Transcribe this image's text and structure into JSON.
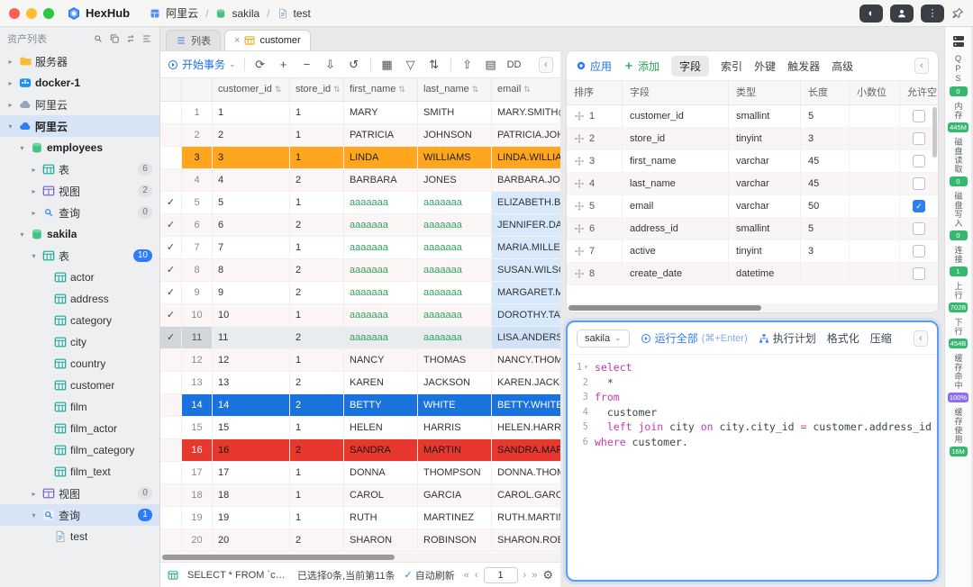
{
  "titlebar": {
    "logo": "HexHub",
    "breadcrumb": [
      {
        "icon": "grid-bc",
        "label": "阿里云"
      },
      {
        "icon": "db",
        "label": "sakila"
      },
      {
        "icon": "doc",
        "label": "test"
      }
    ],
    "right_icons": [
      "theme-toggle-icon",
      "user-icon",
      "more-icon",
      "pin-icon"
    ]
  },
  "sidebar": {
    "header": "资产列表",
    "tools": [
      "search-icon",
      "copy-icon",
      "swap-icon",
      "collapse-icon"
    ],
    "items": [
      {
        "id": "servers",
        "depth": 0,
        "arrow": "r",
        "icon": "folder",
        "label": "服务器"
      },
      {
        "id": "docker-1",
        "depth": 0,
        "arrow": "r",
        "icon": "docker",
        "label": "docker-1",
        "bold": true
      },
      {
        "id": "aliyun",
        "depth": 0,
        "arrow": "r",
        "icon": "cloud",
        "label": "阿里云"
      },
      {
        "id": "aliyun-active",
        "depth": 0,
        "arrow": "d",
        "icon": "cloudblue",
        "label": "阿里云",
        "bold": true,
        "selected": true
      },
      {
        "id": "employees",
        "depth": 1,
        "arrow": "d",
        "icon": "db",
        "label": "employees",
        "bold": true
      },
      {
        "id": "employees-tables",
        "depth": 2,
        "arrow": "r",
        "icon": "table",
        "label": "表",
        "badge": "6"
      },
      {
        "id": "employees-views",
        "depth": 2,
        "arrow": "r",
        "icon": "view",
        "label": "视图",
        "badge": "2"
      },
      {
        "id": "employees-queries",
        "depth": 2,
        "arrow": "r",
        "icon": "query",
        "label": "查询",
        "badge": "0"
      },
      {
        "id": "sakila",
        "depth": 1,
        "arrow": "d",
        "icon": "db",
        "label": "sakila",
        "bold": true
      },
      {
        "id": "sakila-tables",
        "depth": 2,
        "arrow": "d",
        "icon": "table",
        "label": "表",
        "badge": "10",
        "badgeBlue": true
      },
      {
        "id": "table-actor",
        "depth": 3,
        "icon": "table",
        "label": "actor"
      },
      {
        "id": "table-address",
        "depth": 3,
        "icon": "table",
        "label": "address"
      },
      {
        "id": "table-category",
        "depth": 3,
        "icon": "table",
        "label": "category"
      },
      {
        "id": "table-city",
        "depth": 3,
        "icon": "table",
        "label": "city"
      },
      {
        "id": "table-country",
        "depth": 3,
        "icon": "table",
        "label": "country"
      },
      {
        "id": "table-customer",
        "depth": 3,
        "icon": "table",
        "label": "customer"
      },
      {
        "id": "table-film",
        "depth": 3,
        "icon": "table",
        "label": "film"
      },
      {
        "id": "table-film-actor",
        "depth": 3,
        "icon": "table",
        "label": "film_actor"
      },
      {
        "id": "table-film-category",
        "depth": 3,
        "icon": "table",
        "label": "film_category"
      },
      {
        "id": "table-film-text",
        "depth": 3,
        "icon": "table",
        "label": "film_text"
      },
      {
        "id": "sakila-views",
        "depth": 2,
        "arrow": "r",
        "icon": "view",
        "label": "视图",
        "badge": "0"
      },
      {
        "id": "sakila-queries",
        "depth": 2,
        "arrow": "d",
        "icon": "query",
        "label": "查询",
        "badge": "1",
        "badgeBlue": true,
        "selected": true
      },
      {
        "id": "query-test",
        "depth": 3,
        "icon": "doc",
        "label": "test"
      }
    ]
  },
  "tabs": [
    {
      "id": "list",
      "icon": "list",
      "label": "列表",
      "active": false,
      "closable": false
    },
    {
      "id": "customer",
      "icon": "tableorange",
      "label": "customer",
      "active": true,
      "closable": true
    }
  ],
  "toolbar": {
    "transaction": "开始事务",
    "icons": [
      {
        "name": "refresh-icon",
        "glyph": "⟳"
      },
      {
        "name": "add-row-icon",
        "glyph": "+"
      },
      {
        "name": "delete-row-icon",
        "glyph": "−"
      },
      {
        "name": "export-icon",
        "glyph": "⇩"
      },
      {
        "name": "undo-icon",
        "glyph": "↺"
      },
      {
        "name": "divider",
        "glyph": ""
      },
      {
        "name": "grid-view-icon",
        "glyph": "▦"
      },
      {
        "name": "filter-icon",
        "glyph": "▽"
      },
      {
        "name": "sort-icon",
        "glyph": "⇅"
      },
      {
        "name": "divider",
        "glyph": ""
      },
      {
        "name": "import-icon",
        "glyph": "⇧"
      },
      {
        "name": "sheet-icon",
        "glyph": "▤"
      },
      {
        "name": "ddl-button",
        "glyph": "DD"
      }
    ]
  },
  "grid": {
    "columns": [
      "customer_id",
      "store_id",
      "first_name",
      "last_name",
      "email"
    ],
    "rows": [
      {
        "n": "1",
        "cells": [
          "1",
          "1",
          "MARY",
          "SMITH",
          "MARY.SMITH@"
        ]
      },
      {
        "n": "2",
        "cells": [
          "2",
          "1",
          "PATRICIA",
          "JOHNSON",
          "PATRICIA.JOHN"
        ]
      },
      {
        "n": "3",
        "style": "orange",
        "cells": [
          "3",
          "1",
          "LINDA",
          "WILLIAMS",
          "LINDA.WILLIAM"
        ]
      },
      {
        "n": "4",
        "cells": [
          "4",
          "2",
          "BARBARA",
          "JONES",
          "BARBARA.JON"
        ]
      },
      {
        "n": "5",
        "checked": true,
        "edited": true,
        "sel": true,
        "cells": [
          "5",
          "1",
          "aaaaaaa",
          "aaaaaaa",
          "ELIZABETH.BR"
        ]
      },
      {
        "n": "6",
        "checked": true,
        "edited": true,
        "sel": true,
        "cells": [
          "6",
          "2",
          "aaaaaaa",
          "aaaaaaa",
          "JENNIFER.DAV"
        ]
      },
      {
        "n": "7",
        "checked": true,
        "edited": true,
        "sel": true,
        "cells": [
          "7",
          "1",
          "aaaaaaa",
          "aaaaaaa",
          "MARIA.MILLER"
        ]
      },
      {
        "n": "8",
        "checked": true,
        "edited": true,
        "sel": true,
        "cells": [
          "8",
          "2",
          "aaaaaaa",
          "aaaaaaa",
          "SUSAN.WILSO"
        ]
      },
      {
        "n": "9",
        "checked": true,
        "edited": true,
        "sel": true,
        "cells": [
          "9",
          "2",
          "aaaaaaa",
          "aaaaaaa",
          "MARGARET.MO"
        ]
      },
      {
        "n": "10",
        "checked": true,
        "edited": true,
        "sel": true,
        "cells": [
          "10",
          "1",
          "aaaaaaa",
          "aaaaaaa",
          "DOROTHY.TAY"
        ]
      },
      {
        "n": "11",
        "checked": true,
        "edited": true,
        "sel": true,
        "current": true,
        "cells": [
          "11",
          "2",
          "aaaaaaa",
          "aaaaaaa",
          "LISA.ANDERSO"
        ]
      },
      {
        "n": "12",
        "cells": [
          "12",
          "1",
          "NANCY",
          "THOMAS",
          "NANCY.THOMA"
        ]
      },
      {
        "n": "13",
        "cells": [
          "13",
          "2",
          "KAREN",
          "JACKSON",
          "KAREN.JACKSO"
        ]
      },
      {
        "n": "14",
        "style": "blue",
        "cells": [
          "14",
          "2",
          "BETTY",
          "WHITE",
          "BETTY.WHITE@"
        ]
      },
      {
        "n": "15",
        "cells": [
          "15",
          "1",
          "HELEN",
          "HARRIS",
          "HELEN.HARRIS"
        ]
      },
      {
        "n": "16",
        "style": "red",
        "cells": [
          "16",
          "2",
          "SANDRA",
          "MARTIN",
          "SANDRA.MART"
        ]
      },
      {
        "n": "17",
        "cells": [
          "17",
          "1",
          "DONNA",
          "THOMPSON",
          "DONNA.THOM"
        ]
      },
      {
        "n": "18",
        "cells": [
          "18",
          "1",
          "CAROL",
          "GARCIA",
          "CAROL.GARCIA"
        ]
      },
      {
        "n": "19",
        "cells": [
          "19",
          "1",
          "RUTH",
          "MARTINEZ",
          "RUTH.MARTIN"
        ]
      },
      {
        "n": "20",
        "cells": [
          "20",
          "2",
          "SHARON",
          "ROBINSON",
          "SHARON.ROBI"
        ]
      }
    ]
  },
  "status": {
    "query": "SELECT * FROM `customer...",
    "selection": "已选择0条,当前第11条",
    "autorefresh": "自动刷新",
    "page": "1",
    "pag_first": "«",
    "pag_prev": "‹",
    "pag_next": "›",
    "pag_last": "»"
  },
  "fields": {
    "tabs": [
      {
        "label": "应用",
        "style": "blue",
        "icon": "target"
      },
      {
        "label": "添加",
        "style": "green",
        "icon": "plusg"
      },
      {
        "label": "字段",
        "active": true
      },
      {
        "label": "索引"
      },
      {
        "label": "外键"
      },
      {
        "label": "触发器"
      },
      {
        "label": "高级"
      }
    ],
    "columns": [
      "排序",
      "字段",
      "类型",
      "长度",
      "小数位",
      "允许空"
    ],
    "rows": [
      {
        "n": "1",
        "name": "customer_id",
        "type": "smallint",
        "len": "5",
        "dec": "",
        "nullable": false
      },
      {
        "n": "2",
        "name": "store_id",
        "type": "tinyint",
        "len": "3",
        "dec": "",
        "nullable": false
      },
      {
        "n": "3",
        "name": "first_name",
        "type": "varchar",
        "len": "45",
        "dec": "",
        "nullable": false
      },
      {
        "n": "4",
        "name": "last_name",
        "type": "varchar",
        "len": "45",
        "dec": "",
        "nullable": false
      },
      {
        "n": "5",
        "name": "email",
        "type": "varchar",
        "len": "50",
        "dec": "",
        "nullable": true
      },
      {
        "n": "6",
        "name": "address_id",
        "type": "smallint",
        "len": "5",
        "dec": "",
        "nullable": false
      },
      {
        "n": "7",
        "name": "active",
        "type": "tinyint",
        "len": "3",
        "dec": "",
        "nullable": false
      },
      {
        "n": "8",
        "name": "create_date",
        "type": "datetime",
        "len": "",
        "dec": "",
        "nullable": false
      }
    ]
  },
  "sql": {
    "db": "sakila",
    "run": "运行全部",
    "run_hint": "(⌘+Enter)",
    "plan": "执行计划",
    "format": "格式化",
    "compress": "压缩",
    "lines": [
      [
        [
          "k",
          "select"
        ]
      ],
      [
        [
          "t",
          "  *"
        ]
      ],
      [
        [
          "k",
          "from"
        ]
      ],
      [
        [
          "t",
          "  customer"
        ]
      ],
      [
        [
          "t",
          "  "
        ],
        [
          "k",
          "left join"
        ],
        [
          "t",
          " city "
        ],
        [
          "k",
          "on"
        ],
        [
          "t",
          " city.city_id "
        ],
        [
          "o",
          "="
        ],
        [
          "t",
          " customer.address_id"
        ]
      ],
      [
        [
          "k",
          "where"
        ],
        [
          "t",
          " customer."
        ]
      ]
    ]
  },
  "monitor": {
    "items": [
      {
        "label": "QPS",
        "value": "0",
        "color": "green"
      },
      {
        "label": "内存",
        "value": "445M",
        "color": "green"
      },
      {
        "label": "磁盘读取",
        "value": "0",
        "color": "green"
      },
      {
        "label": "磁盘写入",
        "value": "0",
        "color": "green"
      },
      {
        "label": "连接",
        "value": "1",
        "color": "green"
      },
      {
        "label": "上行",
        "value": "702B",
        "color": "green"
      },
      {
        "label": "下行",
        "value": "454B",
        "color": "green"
      },
      {
        "label": "缓存命中",
        "value": "100%",
        "color": "purple"
      },
      {
        "label": "缓存使用",
        "value": "16M",
        "color": "green"
      }
    ]
  }
}
